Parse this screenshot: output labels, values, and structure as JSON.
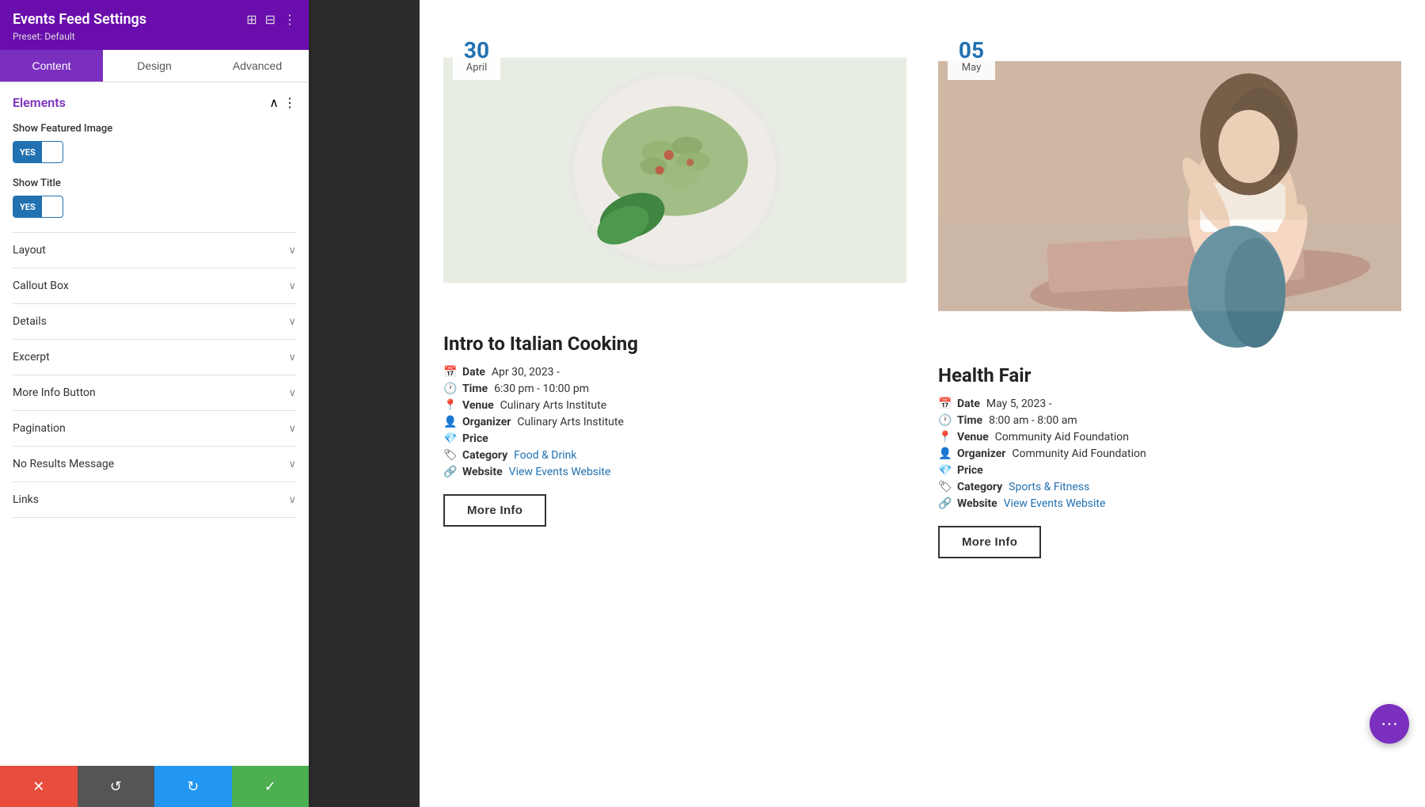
{
  "sidebar": {
    "title": "Events Feed Settings",
    "preset": "Preset: Default",
    "tabs": [
      {
        "id": "content",
        "label": "Content",
        "active": true
      },
      {
        "id": "design",
        "label": "Design",
        "active": false
      },
      {
        "id": "advanced",
        "label": "Advanced",
        "active": false
      }
    ],
    "elements_section": {
      "title": "Elements",
      "fields": [
        {
          "id": "show_featured_image",
          "label": "Show Featured Image",
          "value": "YES"
        },
        {
          "id": "show_title",
          "label": "Show Title",
          "value": "YES"
        }
      ]
    },
    "accordion": [
      {
        "id": "layout",
        "label": "Layout"
      },
      {
        "id": "callout_box",
        "label": "Callout Box"
      },
      {
        "id": "details",
        "label": "Details"
      },
      {
        "id": "excerpt",
        "label": "Excerpt"
      },
      {
        "id": "more_info_button",
        "label": "More Info Button"
      },
      {
        "id": "pagination",
        "label": "Pagination"
      },
      {
        "id": "no_results_message",
        "label": "No Results Message"
      },
      {
        "id": "links",
        "label": "Links"
      }
    ],
    "toolbar": {
      "cancel_label": "✕",
      "undo_label": "↺",
      "redo_label": "↻",
      "save_label": "✓"
    }
  },
  "events": [
    {
      "id": "event1",
      "date_day": "30",
      "date_month": "April",
      "title": "Intro to Italian Cooking",
      "details": [
        {
          "icon": "📅",
          "label": "Date",
          "value": "Apr 30, 2023 -"
        },
        {
          "icon": "🕐",
          "label": "Time",
          "value": "6:30 pm - 10:00 pm"
        },
        {
          "icon": "📍",
          "label": "Venue",
          "value": "Culinary Arts Institute"
        },
        {
          "icon": "👤",
          "label": "Organizer",
          "value": "Culinary Arts Institute"
        },
        {
          "icon": "💎",
          "label": "Price",
          "value": ""
        },
        {
          "icon": "🏷",
          "label": "Category",
          "value": "Food & Drink",
          "is_link": true
        },
        {
          "icon": "🔗",
          "label": "Website",
          "value": "View Events Website",
          "is_link": true
        }
      ],
      "more_info_label": "More Info",
      "image_type": "food"
    },
    {
      "id": "event2",
      "date_day": "05",
      "date_month": "May",
      "title": "Health Fair",
      "details": [
        {
          "icon": "📅",
          "label": "Date",
          "value": "May 5, 2023 -"
        },
        {
          "icon": "🕐",
          "label": "Time",
          "value": "8:00 am - 8:00 am"
        },
        {
          "icon": "📍",
          "label": "Venue",
          "value": "Community Aid Foundation"
        },
        {
          "icon": "👤",
          "label": "Organizer",
          "value": "Community Aid Foundation"
        },
        {
          "icon": "💎",
          "label": "Price",
          "value": ""
        },
        {
          "icon": "🏷",
          "label": "Category",
          "value": "Sports & Fitness",
          "is_link": true
        },
        {
          "icon": "🔗",
          "label": "Website",
          "value": "View Events Website",
          "is_link": true
        }
      ],
      "more_info_label": "More Info",
      "image_type": "yoga"
    }
  ],
  "fab": {
    "icon": "⋯"
  },
  "colors": {
    "sidebar_header_bg": "#6a0dad",
    "active_tab_bg": "#7b2fbe",
    "toggle_bg": "#2271b1",
    "date_day_color": "#2271b1",
    "link_color": "#2271b1",
    "cancel_btn": "#e74c3c",
    "undo_btn": "#555555",
    "redo_btn": "#2196f3",
    "save_btn": "#4caf50",
    "fab_bg": "#7b2fbe"
  }
}
